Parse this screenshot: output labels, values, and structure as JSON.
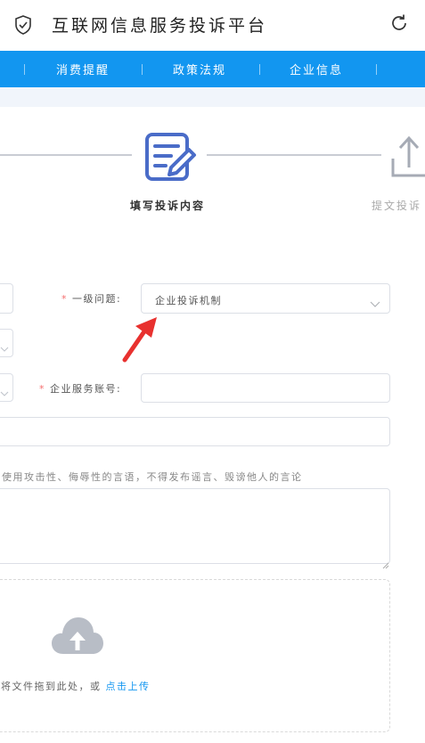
{
  "header": {
    "title": "互联网信息服务投诉平台",
    "shield_icon": "shield-check-icon",
    "refresh_icon": "refresh-icon"
  },
  "nav": {
    "items": [
      "消费提醒",
      "政策法规",
      "企业信息"
    ],
    "color": "#1296f0"
  },
  "steps": {
    "active_label": "填写投诉内容",
    "next_label": "提文投诉",
    "active_icon": "edit-document-icon",
    "next_icon": "upload-icon",
    "active_color": "#4a6cc8"
  },
  "form": {
    "level1_label": "一级问题:",
    "level1_value": "企业投诉机制",
    "account_label": "企业服务账号:",
    "account_value": "",
    "hint_text": "使用攻击性、侮辱性的言语，不得发布谣言、毁谤他人的言论",
    "required_mark": "*"
  },
  "upload": {
    "icon": "cloud-upload-icon",
    "text": "将文件拖到此处，或",
    "link_text": "点击上传"
  },
  "annotation": {
    "arrow_color": "#e8312f"
  }
}
